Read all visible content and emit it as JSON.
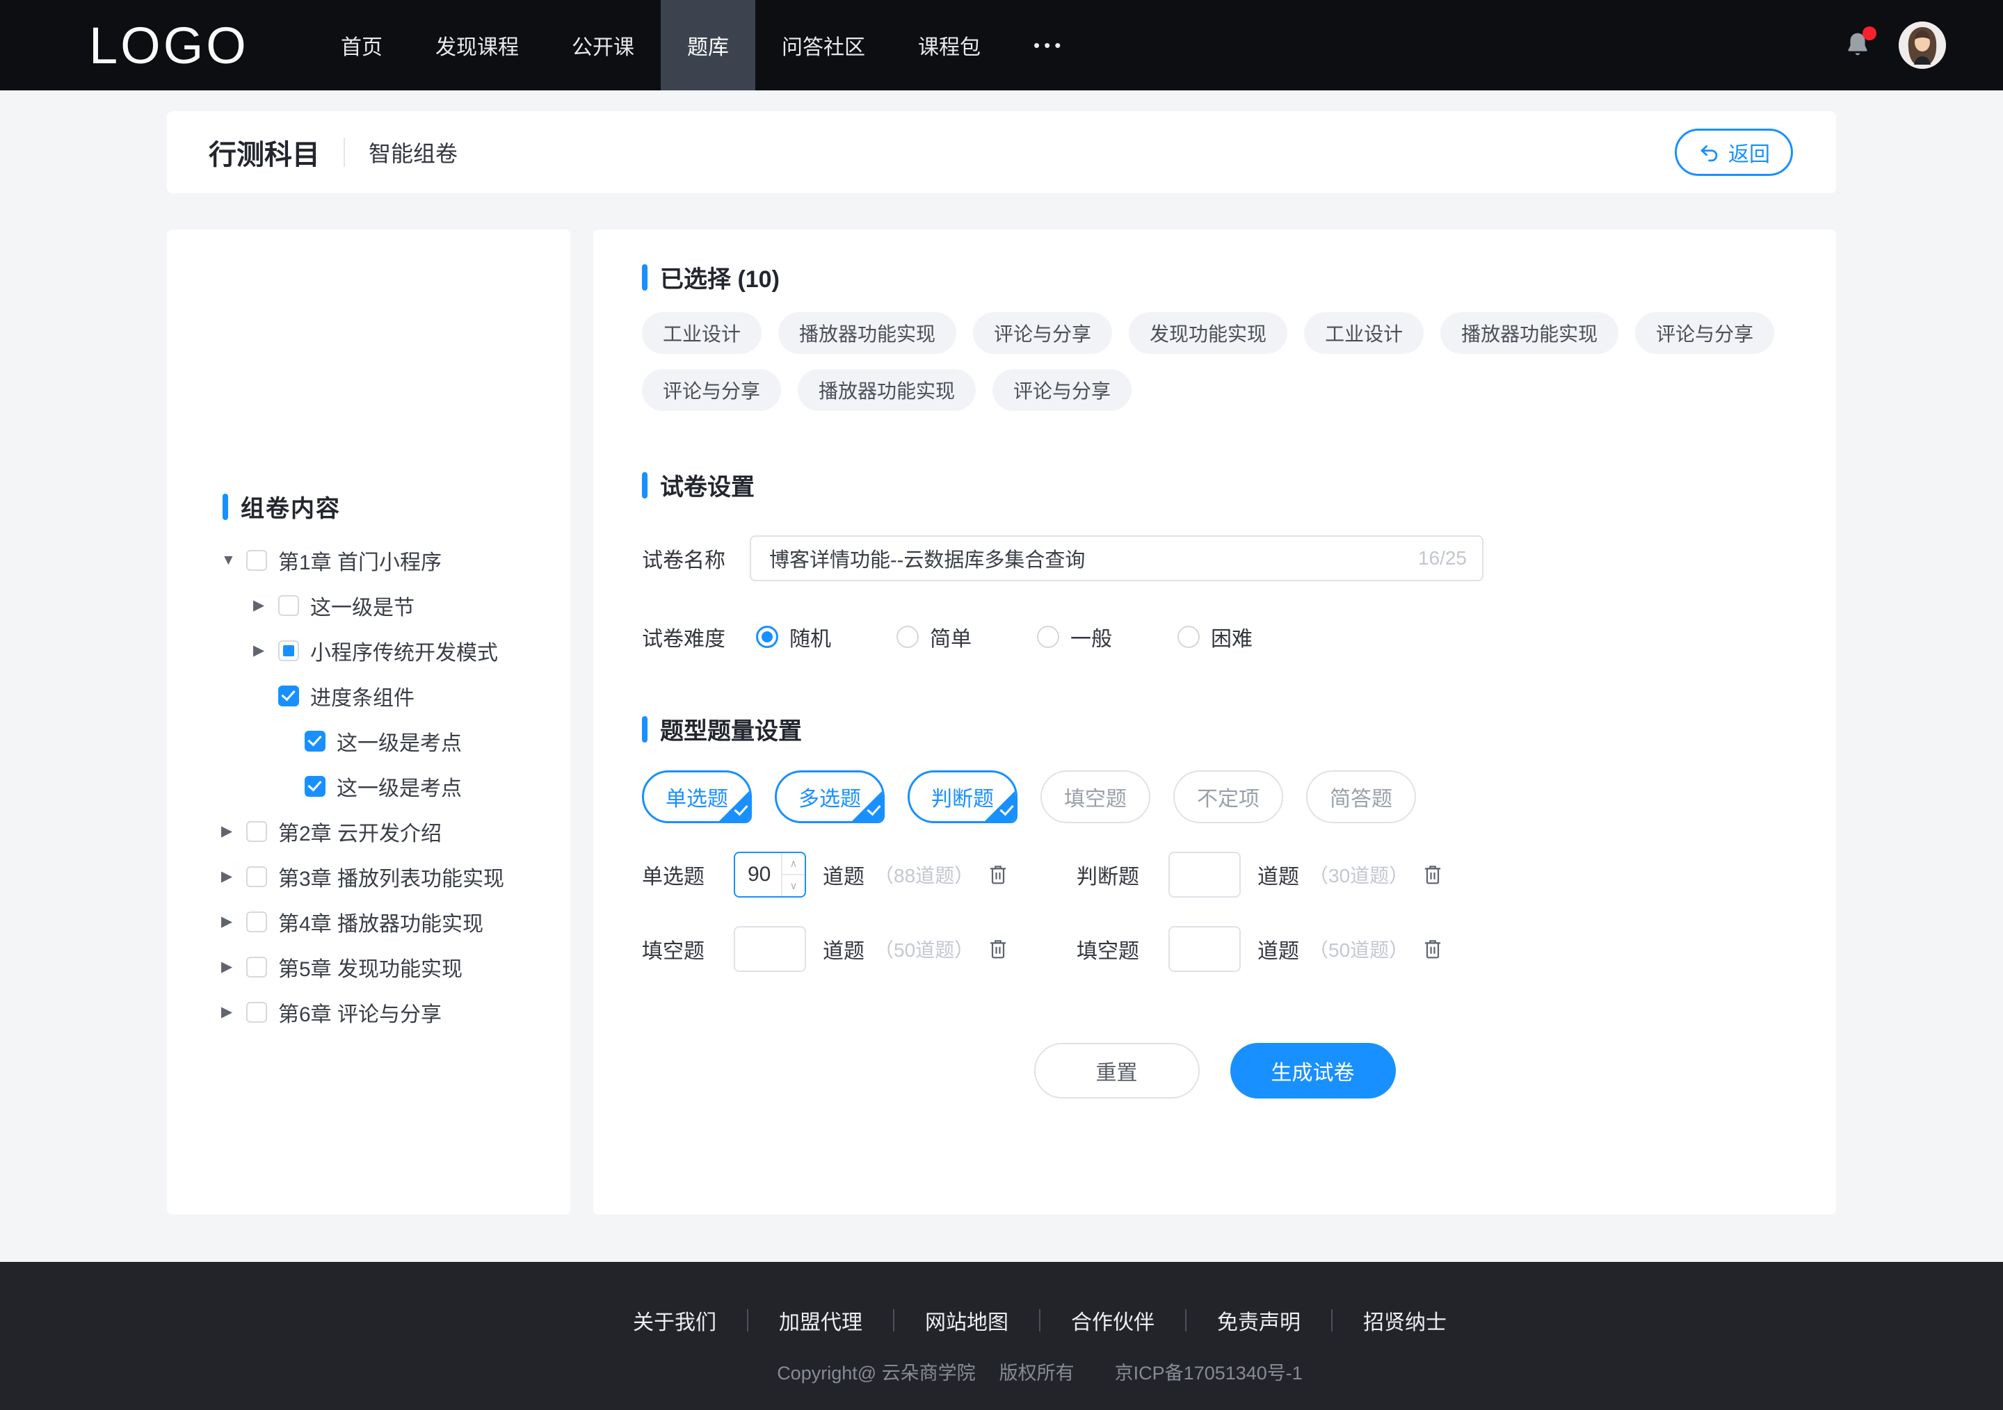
{
  "colors": {
    "accent": "#1890ff",
    "nav_bg": "#0d0e11",
    "nav_active_bg": "#3d434e",
    "footer_bg": "#222429",
    "page_bg": "#f4f5f7",
    "tag_bg": "#f2f3f6",
    "hint": "#c3c7cf",
    "notification_dot": "#f5222d"
  },
  "nav": {
    "logo": "LOGO",
    "items": [
      {
        "label": "首页",
        "active": false
      },
      {
        "label": "发现课程",
        "active": false
      },
      {
        "label": "公开课",
        "active": false
      },
      {
        "label": "题库",
        "active": true
      },
      {
        "label": "问答社区",
        "active": false
      },
      {
        "label": "课程包",
        "active": false
      },
      {
        "label": "•••",
        "active": false
      }
    ],
    "bell_icon": "bell-icon",
    "has_notification": true,
    "avatar_icon": "user-avatar"
  },
  "page_header": {
    "title": "行测科目",
    "subtitle": "智能组卷",
    "back_label": "返回",
    "back_icon": "undo-arrow-icon"
  },
  "sidebar": {
    "title": "组卷内容",
    "tree": [
      {
        "label": "第1章 首门小程序",
        "level": 0,
        "arrow": "down",
        "checkbox": "unchecked"
      },
      {
        "label": "这一级是节",
        "level": 1,
        "arrow": "right",
        "checkbox": "unchecked"
      },
      {
        "label": "小程序传统开发模式",
        "level": 1,
        "arrow": "right",
        "checkbox": "indeterminate"
      },
      {
        "label": "进度条组件",
        "level": 2,
        "arrow": "none",
        "checkbox": "checked"
      },
      {
        "label": "这一级是考点",
        "level": 3,
        "arrow": "none",
        "checkbox": "checked"
      },
      {
        "label": "这一级是考点",
        "level": 3,
        "arrow": "none",
        "checkbox": "checked"
      },
      {
        "label": "第2章 云开发介绍",
        "level": 0,
        "arrow": "right",
        "checkbox": "unchecked"
      },
      {
        "label": "第3章 播放列表功能实现",
        "level": 0,
        "arrow": "right",
        "checkbox": "unchecked"
      },
      {
        "label": "第4章 播放器功能实现",
        "level": 0,
        "arrow": "right",
        "checkbox": "unchecked"
      },
      {
        "label": "第5章 发现功能实现",
        "level": 0,
        "arrow": "right",
        "checkbox": "unchecked"
      },
      {
        "label": "第6章 评论与分享",
        "level": 0,
        "arrow": "right",
        "checkbox": "unchecked"
      }
    ]
  },
  "selected": {
    "title": "已选择 (10)",
    "tags": [
      "工业设计",
      "播放器功能实现",
      "评论与分享",
      "发现功能实现",
      "工业设计",
      "播放器功能实现",
      "评论与分享",
      "评论与分享",
      "播放器功能实现",
      "评论与分享"
    ]
  },
  "paper_settings": {
    "title": "试卷设置",
    "name_label": "试卷名称",
    "name_value": "博客详情功能--云数据库多集合查询",
    "name_counter": "16/25",
    "difficulty_label": "试卷难度",
    "difficulty_options": [
      {
        "label": "随机",
        "selected": true
      },
      {
        "label": "简单",
        "selected": false
      },
      {
        "label": "一般",
        "selected": false
      },
      {
        "label": "困难",
        "selected": false
      }
    ]
  },
  "question_settings": {
    "title": "题型题量设置",
    "types": [
      {
        "label": "单选题",
        "selected": true
      },
      {
        "label": "多选题",
        "selected": true
      },
      {
        "label": "判断题",
        "selected": true
      },
      {
        "label": "填空题",
        "selected": false
      },
      {
        "label": "不定项",
        "selected": false
      },
      {
        "label": "简答题",
        "selected": false
      }
    ],
    "rows": [
      {
        "label": "单选题",
        "value": "90",
        "unit": "道题",
        "hint": "（88道题）",
        "focused": true
      },
      {
        "label": "判断题",
        "value": "",
        "unit": "道题",
        "hint": "（30道题）",
        "focused": false
      },
      {
        "label": "填空题",
        "value": "",
        "unit": "道题",
        "hint": "（50道题）",
        "focused": false
      },
      {
        "label": "填空题",
        "value": "",
        "unit": "道题",
        "hint": "（50道题）",
        "focused": false
      }
    ],
    "reset_label": "重置",
    "generate_label": "生成试卷"
  },
  "footer": {
    "links": [
      "关于我们",
      "加盟代理",
      "网站地图",
      "合作伙伴",
      "免责声明",
      "招贤纳士"
    ],
    "copyright_1": "Copyright@ 云朵商学院",
    "copyright_2": "版权所有",
    "copyright_3": "京ICP备17051340号-1"
  }
}
